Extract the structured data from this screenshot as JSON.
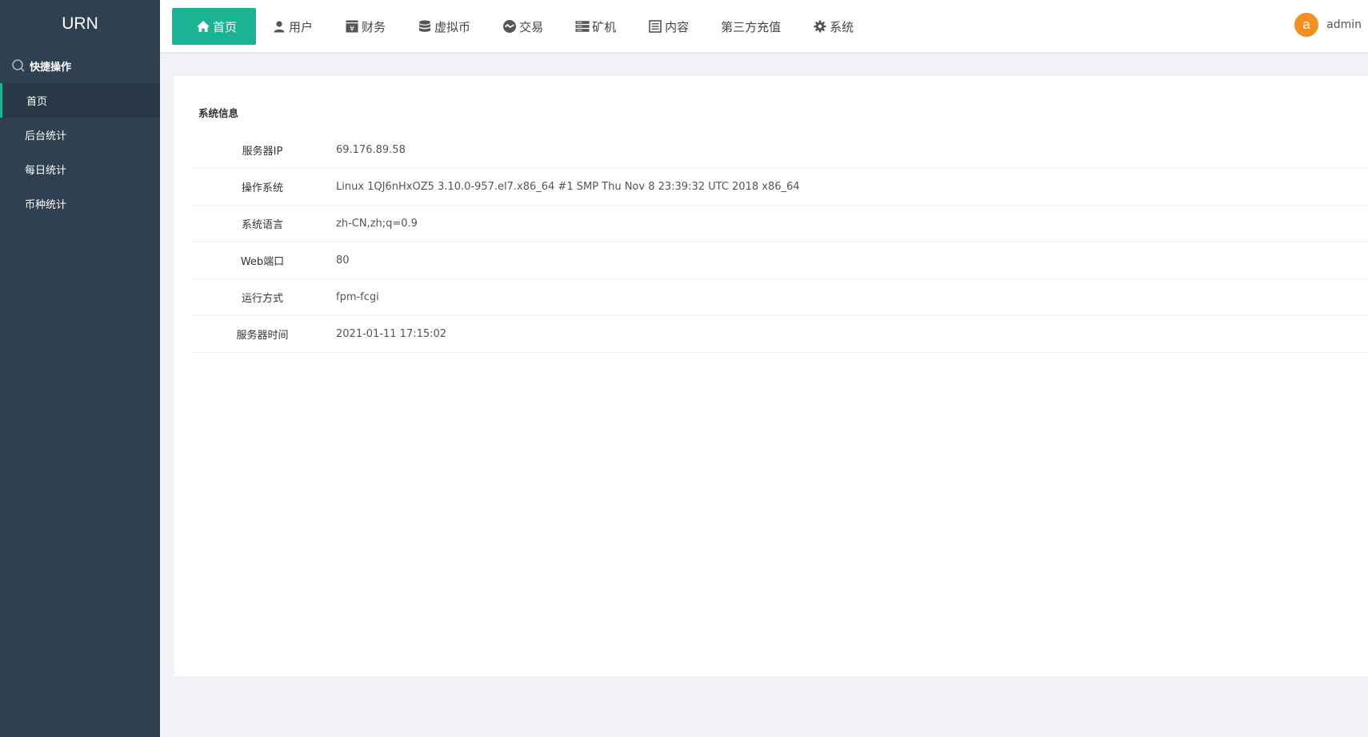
{
  "app": {
    "logo": "URN"
  },
  "sidebar": {
    "quick_label": "快捷操作",
    "items": [
      {
        "label": "首页"
      },
      {
        "label": "后台统计"
      },
      {
        "label": "每日统计"
      },
      {
        "label": "币种统计"
      }
    ]
  },
  "nav": {
    "items": [
      {
        "label": "首页",
        "icon": "home-icon"
      },
      {
        "label": "用户",
        "icon": "user-icon"
      },
      {
        "label": "财务",
        "icon": "yen-box-icon"
      },
      {
        "label": "虚拟币",
        "icon": "database-icon"
      },
      {
        "label": "交易",
        "icon": "exchange-icon"
      },
      {
        "label": "矿机",
        "icon": "server-icon"
      },
      {
        "label": "内容",
        "icon": "list-icon"
      },
      {
        "label": "第三方充值",
        "icon": ""
      },
      {
        "label": "系统",
        "icon": "gear-icon"
      }
    ]
  },
  "user": {
    "avatar_letter": "a",
    "name": "admin"
  },
  "system_info": {
    "title": "系统信息",
    "rows": [
      {
        "key": "服务器IP",
        "value": "69.176.89.58"
      },
      {
        "key": "操作系统",
        "value": "Linux 1QJ6nHxOZ5 3.10.0-957.el7.x86_64 #1 SMP Thu Nov 8 23:39:32 UTC 2018 x86_64"
      },
      {
        "key": "系统语言",
        "value": "zh-CN,zh;q=0.9"
      },
      {
        "key": "Web端口",
        "value": "80"
      },
      {
        "key": "运行方式",
        "value": "fpm-fcgi"
      },
      {
        "key": "服务器时间",
        "value": "2021-01-11 17:15:02"
      }
    ]
  },
  "colors": {
    "sidebar_bg": "#2f4050",
    "accent": "#1ab394",
    "avatar_bg": "#f58f1f"
  }
}
